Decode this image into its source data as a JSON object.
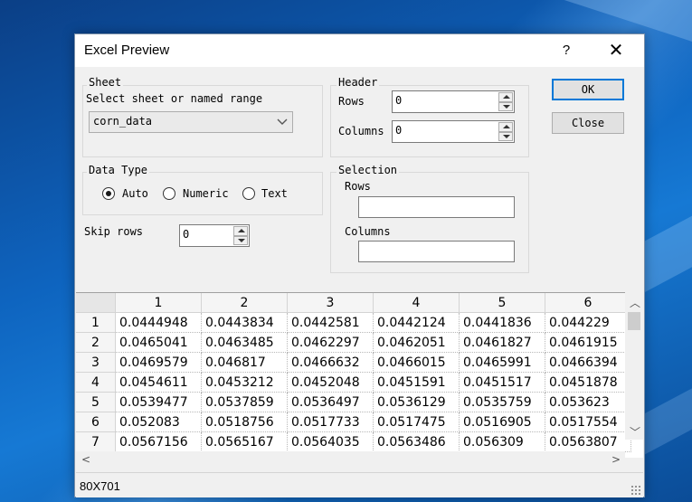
{
  "window": {
    "title": "Excel Preview",
    "help": "?",
    "close": "✕"
  },
  "sheet": {
    "group_label": "Sheet",
    "prompt": "Select sheet or named range",
    "selected": "corn_data"
  },
  "header": {
    "group_label": "Header",
    "rows_label": "Rows",
    "rows_value": "0",
    "columns_label": "Columns",
    "columns_value": "0"
  },
  "buttons": {
    "ok": "OK",
    "close": "Close"
  },
  "data_type": {
    "group_label": "Data Type",
    "options": [
      "Auto",
      "Numeric",
      "Text"
    ],
    "selected": "Auto"
  },
  "selection": {
    "group_label": "Selection",
    "rows_label": "Rows",
    "rows_value": "",
    "columns_label": "Columns",
    "columns_value": ""
  },
  "skip_rows": {
    "label": "Skip rows",
    "value": "0"
  },
  "grid": {
    "columns": [
      "1",
      "2",
      "3",
      "4",
      "5",
      "6"
    ],
    "rows": [
      {
        "index": "1",
        "cells": [
          "0.0444948",
          "0.0443834",
          "0.0442581",
          "0.0442124",
          "0.0441836",
          "0.044229"
        ]
      },
      {
        "index": "2",
        "cells": [
          "0.0465041",
          "0.0463485",
          "0.0462297",
          "0.0462051",
          "0.0461827",
          "0.0461915"
        ]
      },
      {
        "index": "3",
        "cells": [
          "0.0469579",
          "0.046817",
          "0.0466632",
          "0.0466015",
          "0.0465991",
          "0.0466394"
        ]
      },
      {
        "index": "4",
        "cells": [
          "0.0454611",
          "0.0453212",
          "0.0452048",
          "0.0451591",
          "0.0451517",
          "0.0451878"
        ]
      },
      {
        "index": "5",
        "cells": [
          "0.0539477",
          "0.0537859",
          "0.0536497",
          "0.0536129",
          "0.0535759",
          "0.053623"
        ]
      },
      {
        "index": "6",
        "cells": [
          "0.052083",
          "0.0518756",
          "0.0517733",
          "0.0517475",
          "0.0516905",
          "0.0517554"
        ]
      },
      {
        "index": "7",
        "cells": [
          "0.0567156",
          "0.0565167",
          "0.0564035",
          "0.0563486",
          "0.056309",
          "0.0563807"
        ]
      }
    ]
  },
  "status": {
    "dimensions": "80X701"
  }
}
